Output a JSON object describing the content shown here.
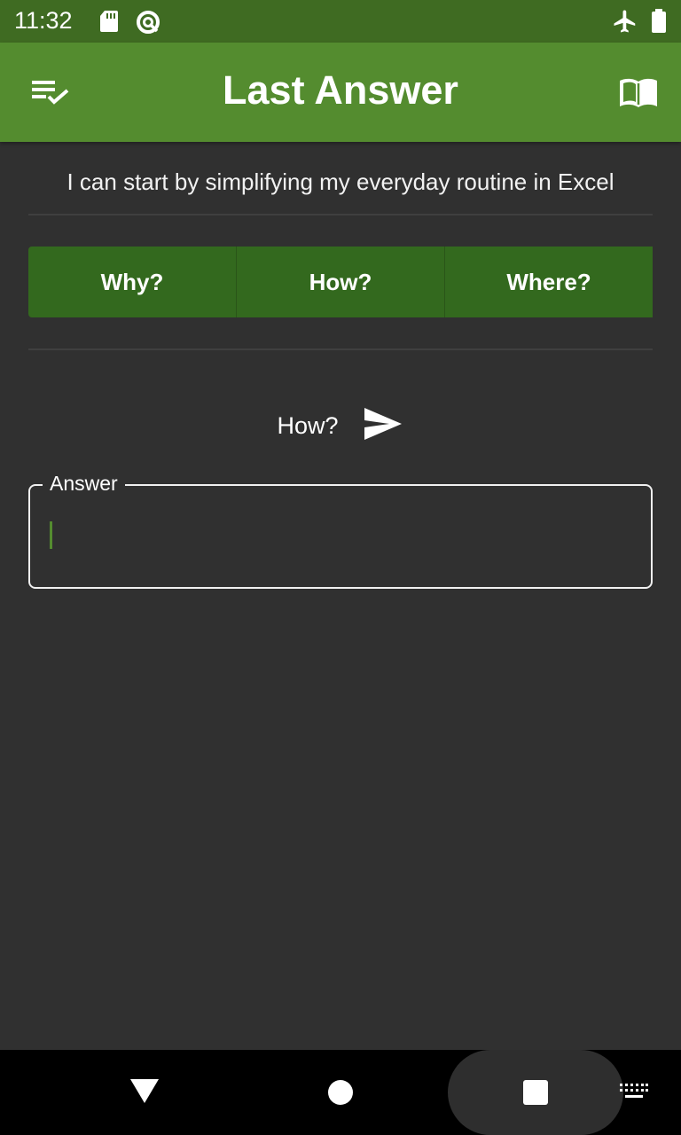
{
  "status_bar": {
    "time": "11:32",
    "icons": [
      "sd-card-icon",
      "data-saver-icon",
      "airplane-mode-icon",
      "battery-full-icon"
    ]
  },
  "app_bar": {
    "title": "Last Answer",
    "left_icon": "checklist-icon",
    "right_icon": "book-open-icon"
  },
  "question": {
    "text": "I can start by simplifying my everyday routine in Excel"
  },
  "buttons": [
    {
      "label": "Why?"
    },
    {
      "label": "How?"
    },
    {
      "label": "Where?"
    }
  ],
  "selected": {
    "label": "How?",
    "send_icon": "send-icon"
  },
  "answer_field": {
    "label": "Answer",
    "value": "",
    "placeholder": ""
  },
  "nav_bar": {
    "icons": [
      "back-icon",
      "home-icon",
      "recents-icon",
      "keyboard-icon"
    ]
  },
  "colors": {
    "status_bar": "#3f6b22",
    "app_bar": "#548c2f",
    "background": "#303030",
    "button": "#33691e",
    "caret": "#548c2f"
  }
}
